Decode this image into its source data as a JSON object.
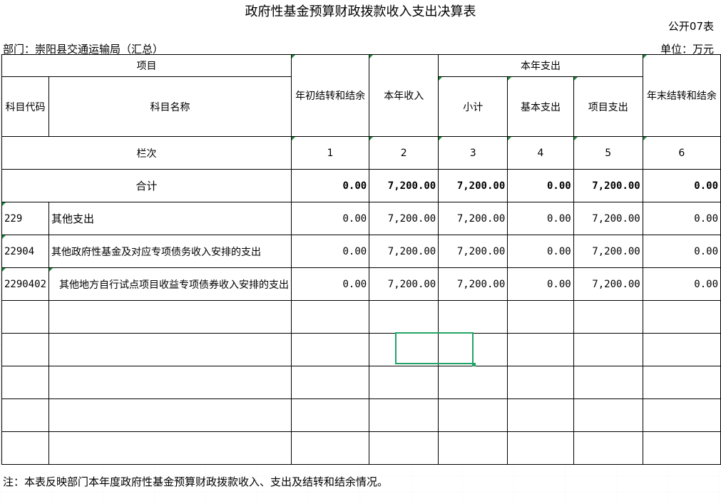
{
  "title": "政府性基金预算财政拨款收入支出决算表",
  "form_no": "公开07表",
  "department": "部门：崇阳县交通运输局（汇总）",
  "unit": "单位：万元",
  "headers": {
    "item": "项目",
    "code": "科目代码",
    "name": "科目名称",
    "opening": "年初结转和结余",
    "income": "本年收入",
    "expense": "本年支出",
    "subtotal": "小计",
    "basic": "基本支出",
    "project": "项目支出",
    "closing": "年末结转和结余",
    "col_label": "栏次",
    "col_nums": [
      "1",
      "2",
      "3",
      "4",
      "5",
      "6"
    ]
  },
  "total": {
    "label": "合计",
    "values": [
      "0.00",
      "7,200.00",
      "7,200.00",
      "0.00",
      "7,200.00",
      "0.00"
    ]
  },
  "rows": [
    {
      "code": "229",
      "name": "其他支出",
      "values": [
        "0.00",
        "7,200.00",
        "7,200.00",
        "0.00",
        "7,200.00",
        "0.00"
      ]
    },
    {
      "code": "22904",
      "name": "其他政府性基金及对应专项债务收入安排的支出",
      "values": [
        "0.00",
        "7,200.00",
        "7,200.00",
        "0.00",
        "7,200.00",
        "0.00"
      ]
    },
    {
      "code": "2290402",
      "name": "其他地方自行试点项目收益专项债券收入安排的支出",
      "values": [
        "0.00",
        "7,200.00",
        "7,200.00",
        "0.00",
        "7,200.00",
        "0.00"
      ]
    }
  ],
  "note": "注：本表反映部门本年度政府性基金预算财政拨款收入、支出及结转和结余情况。"
}
